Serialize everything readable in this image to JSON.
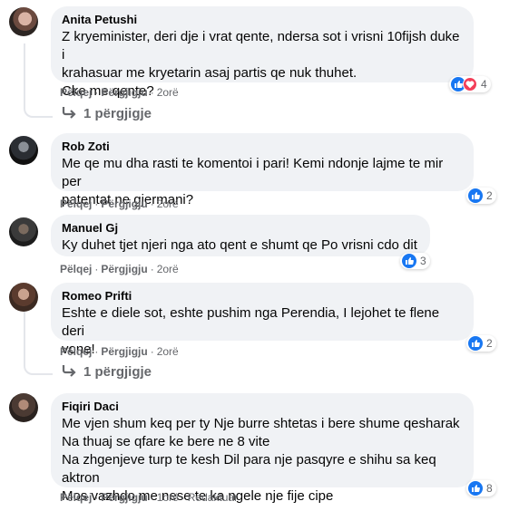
{
  "colors": {
    "like": "#1877f2",
    "love": "#f33e58",
    "bubble": "#f0f2f5",
    "meta": "#65676b"
  },
  "comments": [
    {
      "author": "Anita Petushi",
      "text": "Z kryeminister, deri dje i vrat qente, ndersa sot i vrisni 10fijsh duke i\nkrahasuar me kryetarin asaj partis qe nuk thuhet.\nCke me qente?",
      "like": "Pëlqej",
      "reply": "Përgjigju",
      "time": "2orë",
      "reaction_icons": [
        "like-icon",
        "love-icon"
      ],
      "reaction_count": "4",
      "replies_label": "1 përgjigje"
    },
    {
      "author": "Rob Zoti",
      "text": "Me qe mu dha rasti te komentoi i pari! Kemi ndonje lajme te mir per\npatentat ne gjermani?",
      "like": "Pëlqej",
      "reply": "Përgjigju",
      "time": "2orë",
      "reaction_icons": [
        "like-icon"
      ],
      "reaction_count": "2"
    },
    {
      "author": "Manuel Gj",
      "text": "Ky duhet tjet njeri nga ato qent e shumt qe Po vrisni cdo dit",
      "like": "Pëlqej",
      "reply": "Përgjigju",
      "time": "2orë",
      "reaction_icons": [
        "like-icon"
      ],
      "reaction_count": "3"
    },
    {
      "author": "Romeo Prifti",
      "text": "Eshte e diele sot, eshte pushim nga Perendia, I lejohet te flene deri\nvone!",
      "like": "Pëlqej",
      "reply": "Përgjigju",
      "time": "2orë",
      "reaction_icons": [
        "like-icon"
      ],
      "reaction_count": "2",
      "replies_label": "1 përgjigje"
    },
    {
      "author": "Fiqiri Daci",
      "text": "Me vjen shum keq per ty Nje burre shtetas i bere shume qesharak\nNa thuaj se qfare ke bere ne 8 vite\nNa zhgenjeve turp te kesh Dil para nje pasqyre e shihu sa keq aktron\nMos vazhdo me nese te ka ngele nje fije cipe",
      "like": "Pëlqej",
      "reply": "Përgjigju",
      "time": "1orë",
      "edited": "Redaktuar",
      "reaction_icons": [
        "like-icon"
      ],
      "reaction_count": "8"
    }
  ]
}
